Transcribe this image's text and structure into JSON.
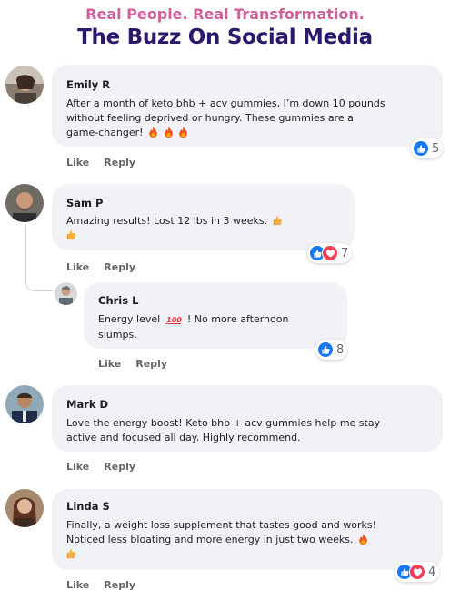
{
  "header": {
    "tagline": "Real People. Real Transformation.",
    "title": "The Buzz On Social Media"
  },
  "actions": {
    "like": "Like",
    "reply": "Reply"
  },
  "colors": {
    "tagline": "#d0609a",
    "title": "#2b1a6b",
    "like": "#1877f2",
    "love": "#f33e58",
    "bubble": "#f0f2f5"
  },
  "comments": [
    {
      "name": "Emily R",
      "lines": [
        "After a month of keto bhb + acv gummies, I’m down 10 pounds",
        "without feeling deprived or hungry. These gummies are a",
        "game-changer!"
      ],
      "emoji": "fire x3",
      "reactions": [
        "like"
      ],
      "count": "5"
    },
    {
      "name": "Sam P",
      "lines": [
        "Amazing results! Lost 12 lbs in 3 weeks."
      ],
      "emoji": "thumbs-up x2",
      "reactions": [
        "like",
        "love"
      ],
      "count": "7"
    },
    {
      "name": "Chris L",
      "lines": [
        "Energy level",
        "! No more afternoon",
        "slumps."
      ],
      "emoji": "100",
      "reactions": [
        "like"
      ],
      "count": "8"
    },
    {
      "name": "Mark D",
      "lines": [
        "Love the energy boost! Keto bhb + acv gummies help me stay",
        "active and focused all day. Highly recommend."
      ],
      "reactions": [],
      "count": ""
    },
    {
      "name": "Linda S",
      "lines": [
        "Finally, a weight loss supplement that tastes good and works!",
        "Noticed less bloating and more energy in just two weeks."
      ],
      "emoji": "fire, thumbs-up",
      "reactions": [
        "like",
        "love"
      ],
      "count": "4"
    }
  ]
}
